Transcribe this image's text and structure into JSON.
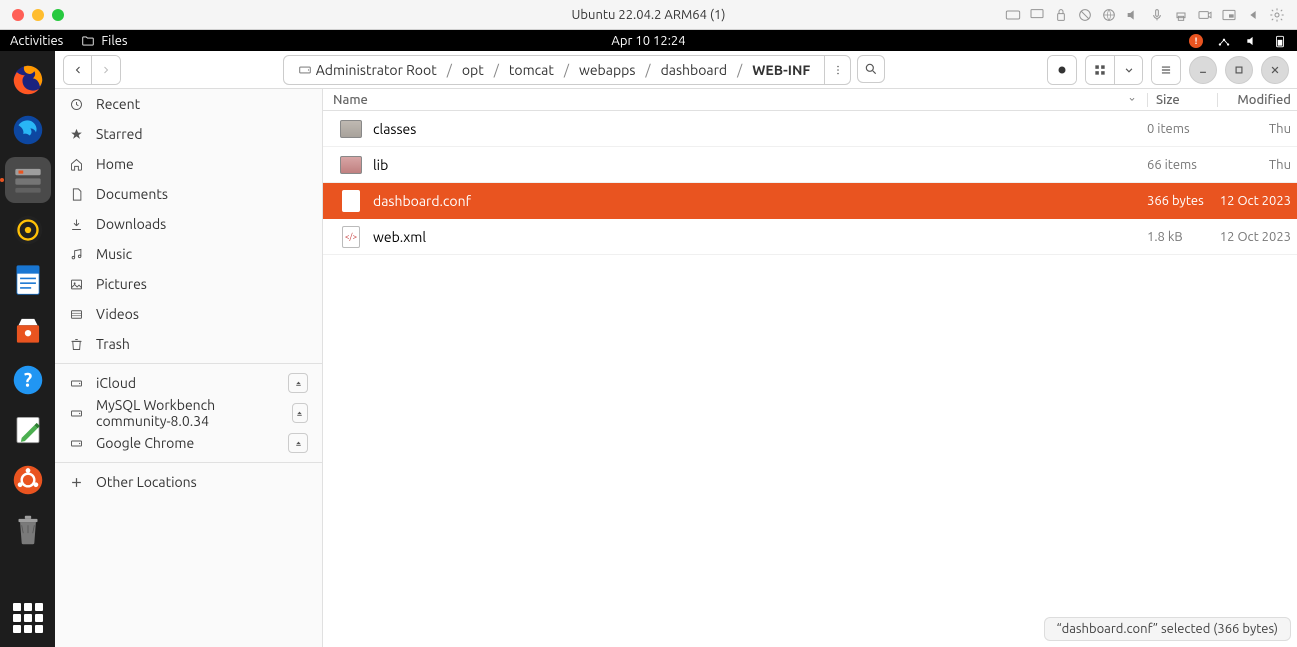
{
  "mac": {
    "title": "Ubuntu 22.04.2 ARM64 (1)"
  },
  "gnome": {
    "activities": "Activities",
    "app_label": "Files",
    "clock": "Apr 10  12:24"
  },
  "toolbar": {
    "breadcrumb": [
      "Administrator Root",
      "opt",
      "tomcat",
      "webapps",
      "dashboard",
      "WEB-INF"
    ]
  },
  "sidebar": {
    "items": [
      {
        "label": "Recent",
        "icon": "recent"
      },
      {
        "label": "Starred",
        "icon": "star"
      },
      {
        "label": "Home",
        "icon": "home"
      },
      {
        "label": "Documents",
        "icon": "documents"
      },
      {
        "label": "Downloads",
        "icon": "downloads"
      },
      {
        "label": "Music",
        "icon": "music"
      },
      {
        "label": "Pictures",
        "icon": "pictures"
      },
      {
        "label": "Videos",
        "icon": "videos"
      },
      {
        "label": "Trash",
        "icon": "trash"
      },
      {
        "label": "iCloud",
        "icon": "drive",
        "eject": true
      },
      {
        "label": "MySQL Workbench community-8.0.34",
        "icon": "drive",
        "eject": true
      },
      {
        "label": "Google Chrome",
        "icon": "drive",
        "eject": true
      }
    ],
    "other_locations": "Other Locations"
  },
  "columns": {
    "name": "Name",
    "size": "Size",
    "modified": "Modified"
  },
  "files": [
    {
      "name": "classes",
      "type": "folder",
      "size": "0 items",
      "modified": "Thu",
      "selected": false
    },
    {
      "name": "lib",
      "type": "folder-red",
      "size": "66 items",
      "modified": "Thu",
      "selected": false
    },
    {
      "name": "dashboard.conf",
      "type": "file",
      "size": "366 bytes",
      "modified": "12 Oct 2023",
      "selected": true
    },
    {
      "name": "web.xml",
      "type": "file-xml",
      "size": "1.8 kB",
      "modified": "12 Oct 2023",
      "selected": false
    }
  ],
  "status": "“dashboard.conf” selected  (366 bytes)"
}
